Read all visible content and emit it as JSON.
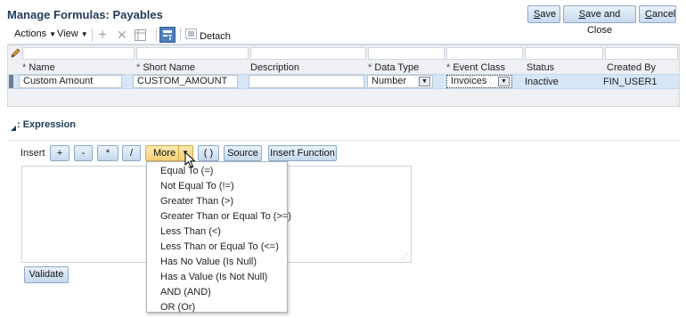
{
  "page": {
    "title": "Manage Formulas: Payables"
  },
  "header_buttons": {
    "save": "Save",
    "save_close": "Save and Close",
    "cancel": "Cancel"
  },
  "toolbar": {
    "actions": "Actions",
    "view": "View",
    "detach": "Detach"
  },
  "table": {
    "columns": [
      {
        "label": "Name",
        "required": true
      },
      {
        "label": "Short Name",
        "required": true
      },
      {
        "label": "Description",
        "required": false
      },
      {
        "label": "Data Type",
        "required": true
      },
      {
        "label": "Event Class",
        "required": true
      },
      {
        "label": "Status",
        "required": false
      },
      {
        "label": "Created By",
        "required": false
      }
    ],
    "required_mark": "*",
    "row": {
      "name": "Custom Amount",
      "short_name": "CUSTOM_AMOUNT",
      "description": "",
      "data_type": "Number",
      "event_class": "Invoices",
      "status": "Inactive",
      "created_by": "FIN_USER1"
    }
  },
  "expression": {
    "section_title": ": Expression",
    "insert_label": "Insert",
    "buttons": {
      "plus": "+",
      "minus": "-",
      "multiply": "*",
      "divide": "/",
      "more": "More",
      "parens": "( )",
      "source": "Source",
      "insert_function": "Insert Function"
    },
    "value": "",
    "validate": "Validate"
  },
  "more_menu": {
    "items": [
      "Equal To (=)",
      "Not Equal To (!=)",
      "Greater Than (>)",
      "Greater Than or Equal To (>=)",
      "Less Than (<)",
      "Less Than or Equal To (<=)",
      "Has No Value (Is Null)",
      "Has a Value (Is Not Null)",
      "AND (AND)",
      "OR (Or)"
    ]
  }
}
